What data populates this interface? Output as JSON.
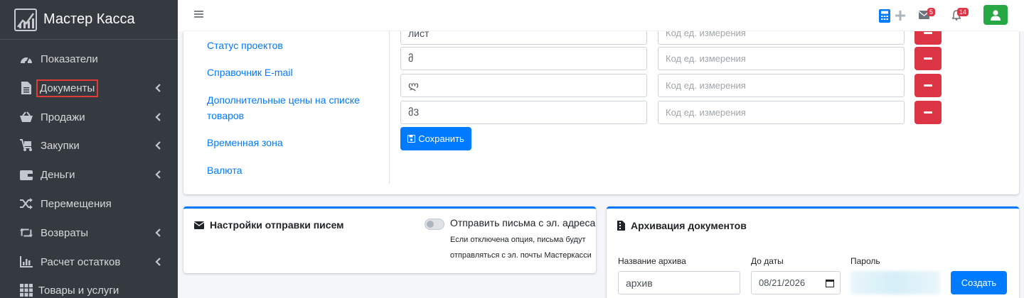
{
  "brand": {
    "name": "Мастер Касса"
  },
  "sidebar": {
    "items": [
      {
        "label": "Показатели",
        "icon": "gauge-icon"
      },
      {
        "label": "Документы",
        "icon": "document-icon"
      },
      {
        "label": "Продажи",
        "icon": "basket-icon"
      },
      {
        "label": "Закупки",
        "icon": "cart-icon"
      },
      {
        "label": "Деньги",
        "icon": "wallet-icon"
      },
      {
        "label": "Перемещения",
        "icon": "shuffle-icon"
      },
      {
        "label": "Возвраты",
        "icon": "retweet-icon"
      },
      {
        "label": "Расчет остатков",
        "icon": "chart-icon"
      },
      {
        "label": "Товары и услуги",
        "icon": "grid-icon"
      }
    ]
  },
  "topbar": {
    "mail_badge": "5",
    "bell_badge": "14",
    "colors": {
      "calculator": "#007bff",
      "user": "#28a745",
      "badge": "#dc3545"
    }
  },
  "settings_links": {
    "links": [
      "Статус проектов",
      "Справочник E-mail",
      "Дополнительные цены на списке товаров",
      "Временная зона",
      "Валюта"
    ]
  },
  "units": {
    "rows": [
      {
        "value": "лист",
        "code_placeholder": "Код ед. измерения"
      },
      {
        "value": "მ",
        "code_placeholder": "Код ед. измерения"
      },
      {
        "value": "ლ",
        "code_placeholder": "Код ед. измерения"
      },
      {
        "value": "მ3",
        "code_placeholder": "Код ед. измерения"
      }
    ],
    "save_label": "Сохранить"
  },
  "mail_settings": {
    "title": "Настройки отправки писем",
    "toggle_label": "Отправить письма с эл. адреса",
    "help_line1": "Если отключена опция, письма будут",
    "help_line2": "отправляться с эл. почты Мастеркасси"
  },
  "archive": {
    "title": "Архивация документов",
    "name_label": "Название архива",
    "name_value": "архив",
    "date_label": "До даты",
    "date_value": "08/21/2026",
    "password_label": "Пароль",
    "create_label": "Создать"
  }
}
